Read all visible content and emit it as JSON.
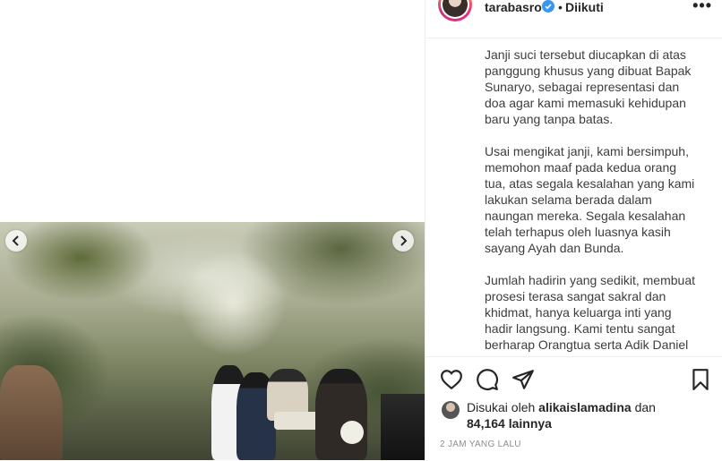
{
  "post": {
    "username": "tarabasro",
    "separator": "•",
    "follow_state": "Diikuti",
    "more_label": "•••"
  },
  "caption": {
    "paragraphs": [
      "Janji suci tersebut diucapkan di atas panggung khusus yang dibuat Bapak Sunaryo, sebagai representasi dan doa agar kami memasuki kehidupan baru yang tanpa batas.",
      "Usai mengikat janji, kami bersimpuh, memohon maaf pada kedua orang tua, atas segala kesalahan yang kami lakukan selama berada dalam naungan mereka. Segala kesalahan telah terhapus oleh luasnya kasih sayang Ayah dan Bunda.",
      "Jumlah hadirin yang sedikit, membuat prosesi terasa sangat sakral dan khidmat, hanya keluarga inti yang hadir langsung. Kami tentu sangat berharap Orangtua serta Adik Daniel"
    ]
  },
  "likes": {
    "prefix": "Disukai oleh",
    "user": "alikaislamadina",
    "connector": "dan",
    "count": "84,164 lainnya"
  },
  "timestamp": "2 JAM YANG LALU",
  "icons": {
    "like": "heart-icon",
    "comment": "comment-icon",
    "share": "paper-plane-icon",
    "save": "bookmark-icon",
    "verified": "verified-badge-icon",
    "prev": "chevron-left-icon",
    "next": "chevron-right-icon"
  },
  "colors": {
    "verified": "#3897f0",
    "text": "#262626",
    "muted": "#8e8e8e"
  }
}
